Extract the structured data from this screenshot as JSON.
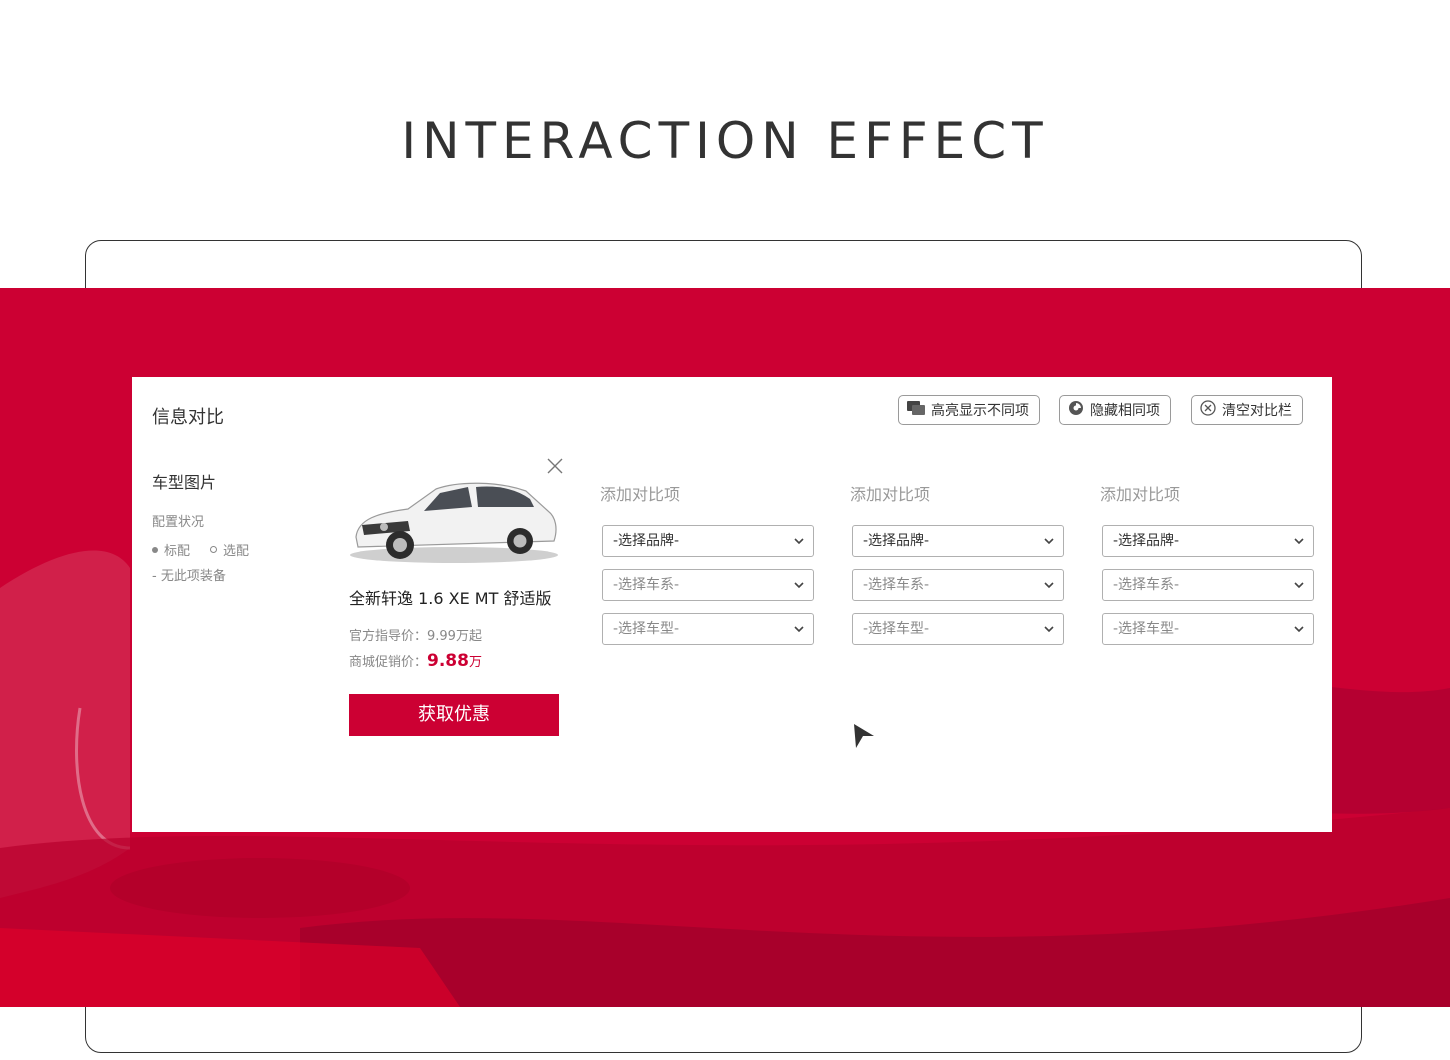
{
  "heading": "INTERACTION EFFECT",
  "panel": {
    "title": "信息对比",
    "toolbar": [
      {
        "label": "高亮显示不同项",
        "icon": "highlight-icon"
      },
      {
        "label": "隐藏相同项",
        "icon": "hide-icon"
      },
      {
        "label": "清空对比栏",
        "icon": "clear-icon"
      }
    ],
    "left": {
      "title": "车型图片",
      "subtitle": "配置状况",
      "legend_standard": "标配",
      "legend_optional": "选配",
      "legend_none": "- 无此项装备"
    },
    "car": {
      "name": "全新轩逸 1.6 XE MT 舒适版",
      "guide_price_label": "官方指导价：9.99万起",
      "promo_label": "商城促销价：",
      "promo_value": "9.88",
      "promo_unit": "万",
      "offer_button": "获取优惠"
    },
    "compare_columns": [
      {
        "title": "添加对比项",
        "brand": "-选择品牌-",
        "series": "-选择车系-",
        "model": "-选择车型-"
      },
      {
        "title": "添加对比项",
        "brand": "-选择品牌-",
        "series": "-选择车系-",
        "model": "-选择车型-"
      },
      {
        "title": "添加对比项",
        "brand": "-选择品牌-",
        "series": "-选择车系-",
        "model": "-选择车型-"
      }
    ]
  },
  "colors": {
    "accent": "#cc0033",
    "text_dark": "#333333",
    "text_muted": "#888888"
  }
}
